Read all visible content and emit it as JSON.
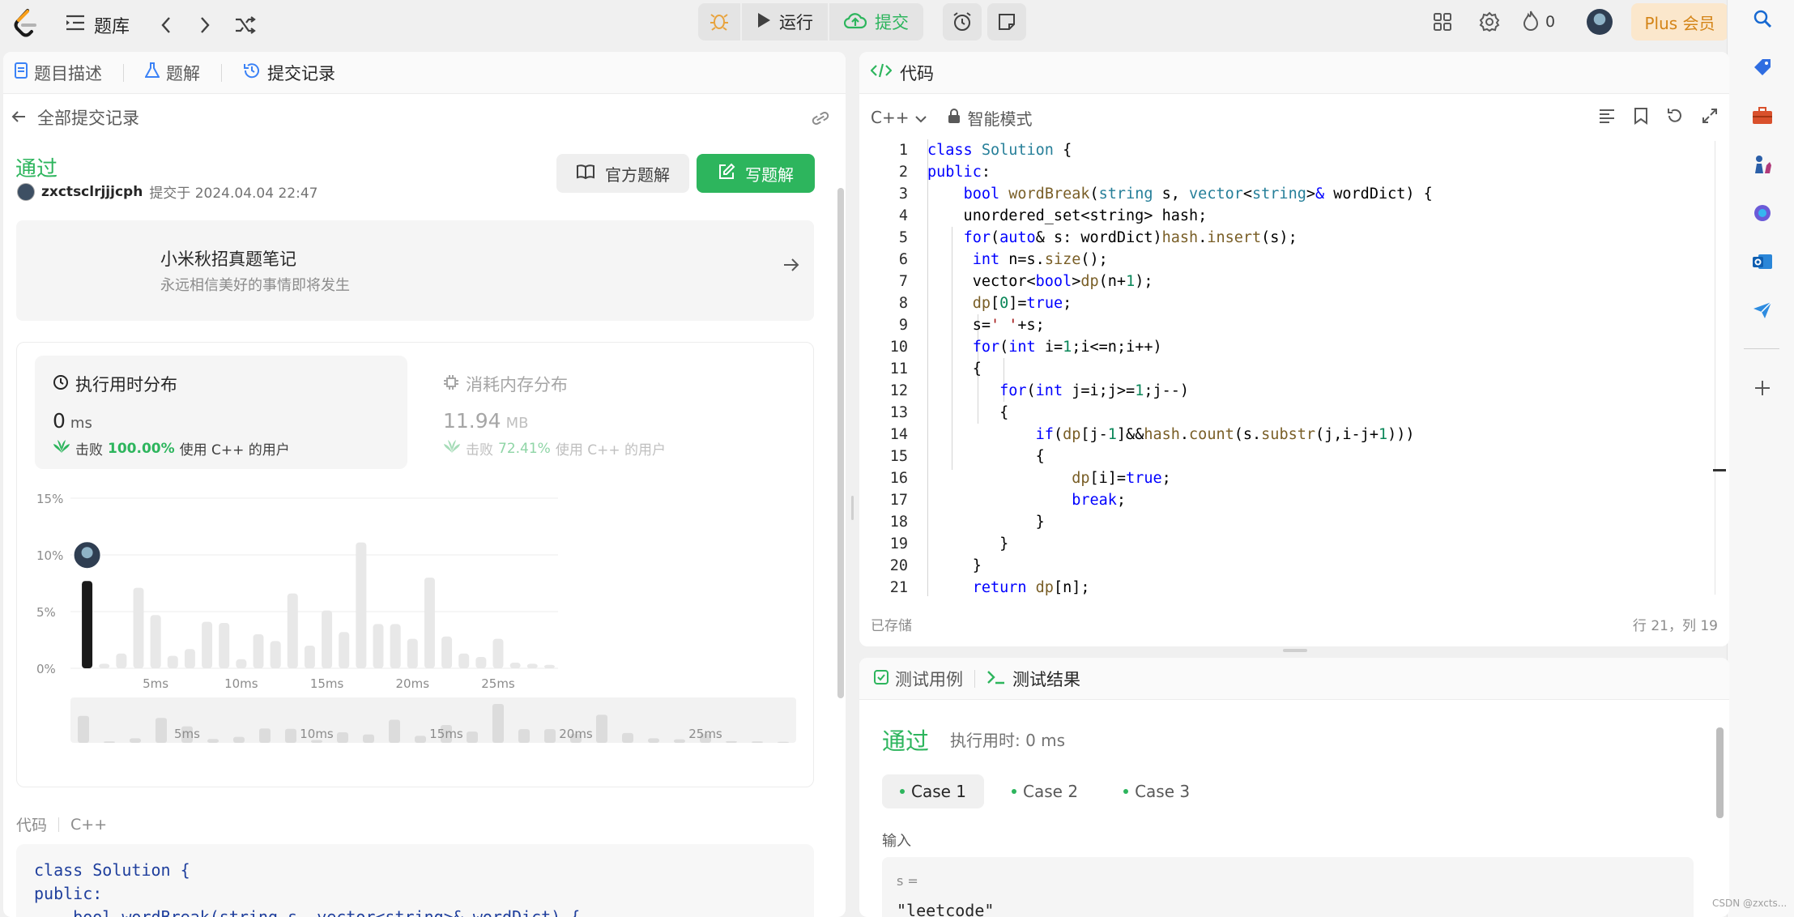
{
  "topbar": {
    "problem_list_label": "题库",
    "run_label": "运行",
    "submit_label": "提交",
    "streak_count": "0",
    "plus_label": "Plus 会员"
  },
  "left_panel": {
    "tabs": [
      {
        "label": "题目描述"
      },
      {
        "label": "题解"
      },
      {
        "label": "提交记录"
      }
    ],
    "back_label": "全部提交记录",
    "status": "通过",
    "username": "zxctsclrjjjcph",
    "submitted_at": "提交于 2024.04.04 22:47",
    "official_solution_label": "官方题解",
    "write_solution_label": "写题解",
    "note_title": "小米秋招真题笔记",
    "note_subtitle": "永远相信美好的事情即将发生",
    "runtime": {
      "title": "执行用时分布",
      "value": "0",
      "unit": "ms",
      "beat_prefix": "击败",
      "beat_pct": "100.00%",
      "beat_suffix": "使用 C++ 的用户"
    },
    "memory": {
      "title": "消耗内存分布",
      "value": "11.94",
      "unit": "MB",
      "beat_prefix": "击败",
      "beat_pct": "72.41%",
      "beat_suffix": "使用 C++ 的用户"
    },
    "code_label": "代码",
    "code_lang": "C++",
    "code_snippet": [
      "class Solution {",
      "public:",
      "    bool wordBreak(string s, vector<string>& wordDict) {"
    ]
  },
  "chart_data": {
    "type": "bar",
    "ylabel_ticks": [
      "15%",
      "10%",
      "5%",
      "0%"
    ],
    "ylim": [
      0,
      15
    ],
    "x_tick_labels": [
      "5ms",
      "10ms",
      "15ms",
      "20ms",
      "25ms"
    ],
    "highlight_index": 0,
    "values": [
      7.7,
      0.4,
      1.3,
      7.1,
      4.7,
      1.1,
      1.7,
      4.1,
      4.0,
      0.8,
      3.0,
      2.4,
      6.6,
      2.0,
      5.1,
      3.2,
      11.1,
      3.9,
      3.9,
      2.6,
      8.0,
      2.8,
      1.3,
      1.0,
      2.6,
      0.5,
      0.4,
      0.3
    ]
  },
  "editor": {
    "tab_label": "代码",
    "lang": "C++",
    "mode": "智能模式",
    "saved_label": "已存储",
    "cursor_pos": "行 21，列 19"
  },
  "test": {
    "tab_cases": "测试用例",
    "tab_results": "测试结果",
    "status": "通过",
    "runtime": "执行用时: 0 ms",
    "cases": [
      "Case 1",
      "Case 2",
      "Case 3"
    ],
    "input_label": "输入",
    "input_var": "s =",
    "input_value": "\"leetcode\""
  },
  "watermark": "CSDN @zxcts..."
}
